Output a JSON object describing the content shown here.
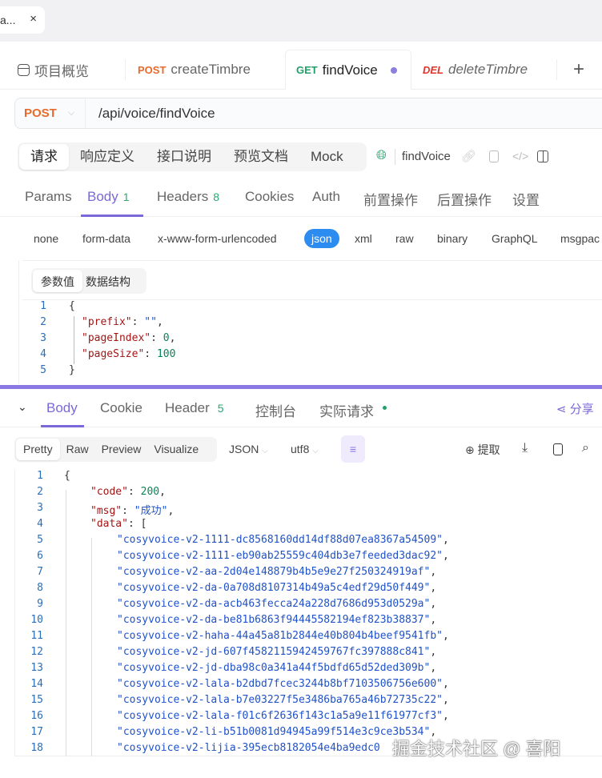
{
  "window_tab": {
    "label": "a...",
    "close": "×"
  },
  "tabs": [
    {
      "label": "项目概览"
    },
    {
      "method": "POST",
      "label": "createTimbre",
      "color": "#e8692c"
    },
    {
      "method": "GET",
      "label": "findVoice",
      "color": "#23a06a"
    },
    {
      "method": "DEL",
      "label": "deleteTimbre",
      "color": "#e0352b"
    }
  ],
  "add_tab": "+",
  "url": {
    "method": "POST",
    "path": "/api/voice/findVoice"
  },
  "subtabs": [
    "请求",
    "响应定义",
    "接口说明",
    "预览文档",
    "Mock"
  ],
  "api_name": "findVoice",
  "params_tabs": {
    "params": "Params",
    "body": "Body",
    "body_count": "1",
    "headers": "Headers",
    "headers_count": "8",
    "cookies": "Cookies",
    "auth": "Auth",
    "pre": "前置操作",
    "post": "后置操作",
    "settings": "设置"
  },
  "body_types": [
    "none",
    "form-data",
    "x-www-form-urlencoded",
    "json",
    "xml",
    "raw",
    "binary",
    "GraphQL",
    "msgpac"
  ],
  "body_mode": [
    "参数值",
    "数据结构"
  ],
  "request_code": [
    [
      [
        "p",
        "{"
      ]
    ],
    [
      [
        "k",
        "\"prefix\""
      ],
      [
        "p",
        ": "
      ],
      [
        "s",
        "\"\""
      ],
      [
        "p",
        ","
      ]
    ],
    [
      [
        "k",
        "\"pageIndex\""
      ],
      [
        "p",
        ": "
      ],
      [
        "n",
        "0"
      ],
      [
        "p",
        ","
      ]
    ],
    [
      [
        "k",
        "\"pageSize\""
      ],
      [
        "p",
        ": "
      ],
      [
        "n",
        "100"
      ]
    ],
    [
      [
        "p",
        "}"
      ]
    ]
  ],
  "response_tabs": {
    "body": "Body",
    "cookie": "Cookie",
    "header": "Header",
    "header_count": "5",
    "console": "控制台",
    "actual": "实际请求",
    "share": "分享"
  },
  "response_toolbar": {
    "views": [
      "Pretty",
      "Raw",
      "Preview",
      "Visualize"
    ],
    "format": "JSON",
    "encoding": "utf8",
    "extract": "提取"
  },
  "response_code": [
    [
      [
        "p",
        "{"
      ]
    ],
    [
      [
        "k",
        "\"code\""
      ],
      [
        "p",
        ": "
      ],
      [
        "n",
        "200"
      ],
      [
        "p",
        ","
      ]
    ],
    [
      [
        "k",
        "\"msg\""
      ],
      [
        "p",
        ": "
      ],
      [
        "s",
        "\"成功\""
      ],
      [
        "p",
        ","
      ]
    ],
    [
      [
        "k",
        "\"data\""
      ],
      [
        "p",
        ": ["
      ]
    ],
    [
      [
        "s",
        "\"cosyvoice-v2-1111-dc8568160dd14df88d07ea8367a54509\""
      ],
      [
        "p",
        ","
      ]
    ],
    [
      [
        "s",
        "\"cosyvoice-v2-1111-eb90ab25559c404db3e7feeded3dac92\""
      ],
      [
        "p",
        ","
      ]
    ],
    [
      [
        "s",
        "\"cosyvoice-v2-aa-2d04e148879b4b5e9e27f250324919af\""
      ],
      [
        "p",
        ","
      ]
    ],
    [
      [
        "s",
        "\"cosyvoice-v2-da-0a708d8107314b49a5c4edf29d50f449\""
      ],
      [
        "p",
        ","
      ]
    ],
    [
      [
        "s",
        "\"cosyvoice-v2-da-acb463fecca24a228d7686d953d0529a\""
      ],
      [
        "p",
        ","
      ]
    ],
    [
      [
        "s",
        "\"cosyvoice-v2-da-be81b6863f94445582194ef823b38837\""
      ],
      [
        "p",
        ","
      ]
    ],
    [
      [
        "s",
        "\"cosyvoice-v2-haha-44a45a81b2844e40b804b4beef9541fb\""
      ],
      [
        "p",
        ","
      ]
    ],
    [
      [
        "s",
        "\"cosyvoice-v2-jd-607f4582115942459767fc397888c841\""
      ],
      [
        "p",
        ","
      ]
    ],
    [
      [
        "s",
        "\"cosyvoice-v2-jd-dba98c0a341a44f5bdfd65d52ded309b\""
      ],
      [
        "p",
        ","
      ]
    ],
    [
      [
        "s",
        "\"cosyvoice-v2-lala-b2dbd7fcec3244b8bf7103506756e600\""
      ],
      [
        "p",
        ","
      ]
    ],
    [
      [
        "s",
        "\"cosyvoice-v2-lala-b7e03227f5e3486ba765a46b72735c22\""
      ],
      [
        "p",
        ","
      ]
    ],
    [
      [
        "s",
        "\"cosyvoice-v2-lala-f01c6f2636f143c1a5a9e11f61977cf3\""
      ],
      [
        "p",
        ","
      ]
    ],
    [
      [
        "s",
        "\"cosyvoice-v2-li-b51b0081d94945a99f514e3c9ce3b534\""
      ],
      [
        "p",
        ","
      ]
    ],
    [
      [
        "s",
        "\"cosyvoice-v2-lijia-395ecb8182054e4ba9edc0"
      ]
    ]
  ],
  "watermark": "掘金技术社区 @ 喜阳",
  "colors": {
    "accent": "#7b68d9",
    "json_btn": "#2d8cf0"
  }
}
